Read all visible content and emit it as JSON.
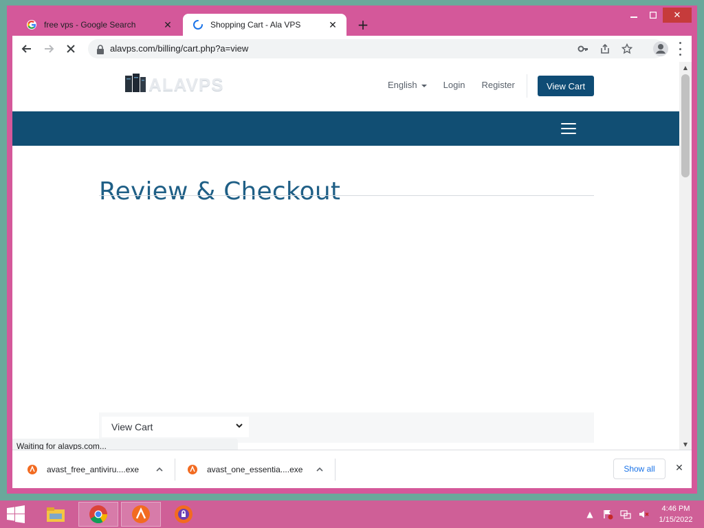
{
  "browser": {
    "tabs": [
      {
        "title": "free vps - Google Search",
        "favicon": "google-icon",
        "active": false
      },
      {
        "title": "Shopping Cart - Ala VPS",
        "favicon": "loading-spinner-icon",
        "active": true
      }
    ],
    "new_tab_icon": "plus-icon",
    "window_controls": {
      "minimize": "minimize-icon",
      "maximize": "maximize-icon",
      "close": "close-icon"
    },
    "address_bar": {
      "url": "alavps.com/billing/cart.php?a=view",
      "lock_icon": "lock-icon"
    },
    "toolbar_icons": [
      "back-icon",
      "forward-icon",
      "stop-icon",
      "key-icon",
      "share-icon",
      "star-icon",
      "profile-icon",
      "menu-icon"
    ],
    "status_text": "Waiting for alavps.com..."
  },
  "site": {
    "logo_text": "ALAVPS",
    "header_links": {
      "language": "English",
      "login": "Login",
      "register": "Register"
    },
    "view_cart_button": "View Cart",
    "page_title": "Review & Checkout",
    "cart_select": {
      "selected": "View Cart"
    },
    "colors": {
      "primary": "#114e73",
      "title": "#1f5f86"
    }
  },
  "downloads": {
    "items": [
      {
        "name": "avast_free_antiviru....exe",
        "icon": "avast-icon"
      },
      {
        "name": "avast_one_essentia....exe",
        "icon": "avast-icon"
      }
    ],
    "show_all_label": "Show all"
  },
  "taskbar": {
    "apps": [
      "file-explorer-icon",
      "chrome-icon",
      "avast-icon",
      "avast-secure-browser-icon"
    ],
    "clock": {
      "time": "4:46 PM",
      "date": "1/15/2022"
    }
  }
}
